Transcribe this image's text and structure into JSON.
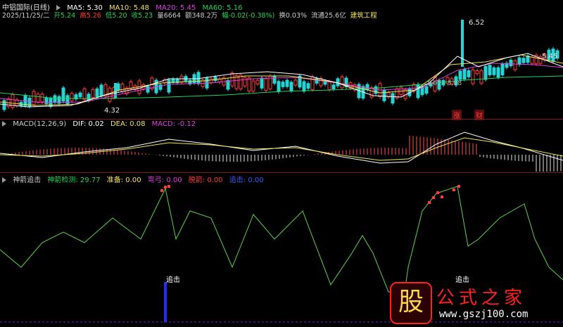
{
  "header": {
    "title": "中铝国际(日线)",
    "ma": [
      {
        "label": "MA5: 5.30",
        "color": "#ffffff"
      },
      {
        "label": "MA10: 5.48",
        "color": "#f2e35a"
      },
      {
        "label": "MA20: 5.45",
        "color": "#e040e0"
      },
      {
        "label": "MA60: 5.16",
        "color": "#27d35a"
      }
    ]
  },
  "quote": {
    "date": "2025/11/25/二",
    "open": "开5.24",
    "high": "高5.26",
    "low": "低5.20",
    "close": "收5.23",
    "volume": "量6664",
    "amount": "额348.2万",
    "change": "幅-0.02(-0.38%)",
    "turnover": "换0.03%",
    "float": "流通25.6亿",
    "sector": "建筑工程",
    "colors": {
      "open": "#27d35a",
      "high": "#ff3b3b",
      "low": "#27d35a",
      "close": "#27d35a",
      "change": "#27d35a"
    }
  },
  "price_labels": {
    "high": "6.52",
    "low": "4.32",
    "right": "5.45",
    "mid1": "5.07",
    "mid2": "5.08"
  },
  "event_tags": [
    "涨",
    "财"
  ],
  "macd": {
    "title": "MACD(12,26,9)",
    "dif": "DIF: 0.02",
    "dea": "DEA: 0.08",
    "macd": "MACD: -0.12",
    "colors": {
      "dif": "#ffffff",
      "dea": "#f2e35a",
      "macd": "#e040e0"
    }
  },
  "indicator": {
    "title": "神箭追击",
    "items": [
      {
        "label": "神箭检测: 29.77",
        "color": "#27d35a"
      },
      {
        "label": "准备: 0.00",
        "color": "#f2e35a"
      },
      {
        "label": "弯弓: 0.00",
        "color": "#e040e0"
      },
      {
        "label": "脱箭: 0.00",
        "color": "#ff3b3b"
      },
      {
        "label": "追击: 0.00",
        "color": "#3b5bff"
      }
    ],
    "signals": [
      "追击",
      "追击"
    ]
  },
  "watermark": {
    "big": "股",
    "text": "公式之家",
    "url": "www.gszj100.com"
  }
}
